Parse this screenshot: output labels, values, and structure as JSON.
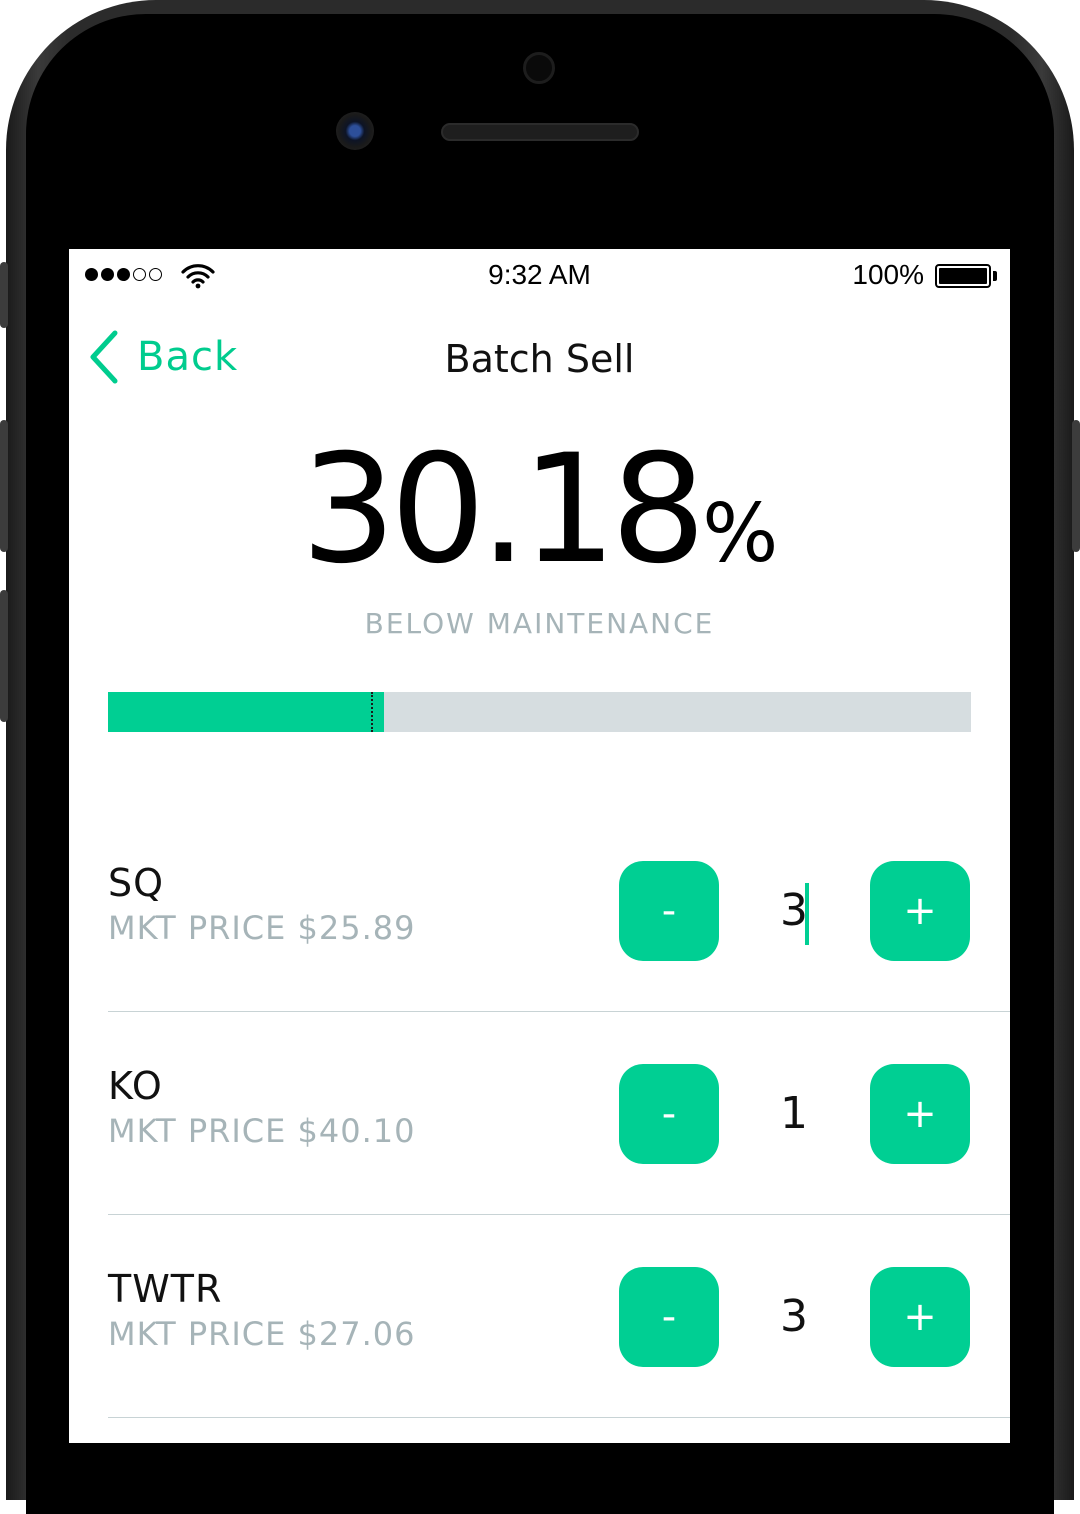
{
  "status_bar": {
    "time": "9:32 AM",
    "battery_percent": "100%",
    "signal_strength": 3,
    "signal_max": 5,
    "icons": [
      "signal-dots-icon",
      "wifi-icon",
      "battery-icon"
    ]
  },
  "nav": {
    "back_label": "Back",
    "back_icon": "chevron-left-icon",
    "title": "Batch Sell"
  },
  "summary": {
    "percent_value": "30.18",
    "percent_sign": "%",
    "caption": "BELOW MAINTENANCE",
    "progress_fraction": 0.32,
    "marker_fraction": 0.305
  },
  "holdings": [
    {
      "ticker": "SQ",
      "price_label": "MKT PRICE $25.89",
      "quantity": "3",
      "minus_label": "-",
      "plus_label": "+",
      "focused": true
    },
    {
      "ticker": "KO",
      "price_label": "MKT PRICE $40.10",
      "quantity": "1",
      "minus_label": "-",
      "plus_label": "+",
      "focused": false
    },
    {
      "ticker": "TWTR",
      "price_label": "MKT PRICE $27.06",
      "quantity": "3",
      "minus_label": "-",
      "plus_label": "+",
      "focused": false
    }
  ],
  "colors": {
    "accent": "#00cf93",
    "muted_text": "#a6b4b8",
    "track": "#d6dde0"
  }
}
